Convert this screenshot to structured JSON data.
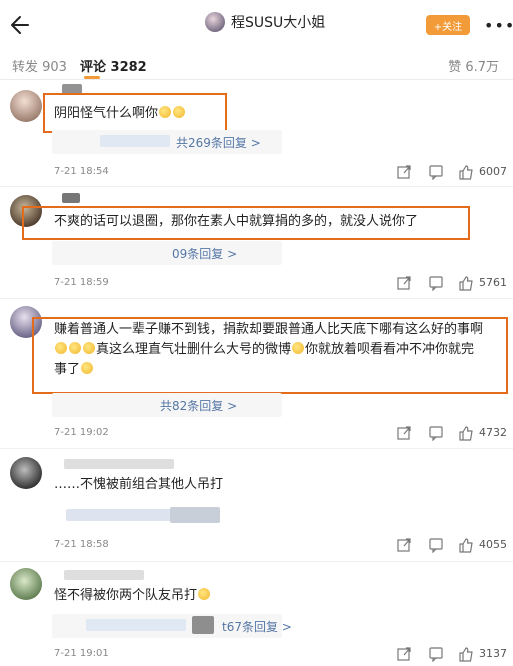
{
  "header": {
    "title": "程SUSU大小姐",
    "follow_label": "+关注",
    "more_glyph": "•••"
  },
  "tabs": {
    "repost": "转发 903",
    "comments": "评论 3282",
    "likes": "赞 6.7万"
  },
  "colors": {
    "accent": "#f29b38",
    "highlight_box": "#e46b1c",
    "link": "#5577a6"
  },
  "icons": [
    "back-arrow-icon",
    "share-icon",
    "comment-icon",
    "like-icon",
    "more-icon"
  ],
  "comments": [
    {
      "text": "阴阳怪气什么啊你",
      "emoji_count": 2,
      "replies": "共269条回复 >",
      "time": "7-21 18:54",
      "likes": "6007"
    },
    {
      "text": "不爽的话可以退圈，那你在素人中就算捐的多的，就没人说你了",
      "replies": "09条回复 >",
      "time": "7-21 18:59",
      "likes": "5761"
    },
    {
      "line1": "赚着普通人一辈子赚不到钱，捐款却要跟普通人比天底下哪有这么好的事啊",
      "line2": "真这么理直气壮删什么大号的微博",
      "line2b": "你就放着呗看看冲不冲你就完",
      "line3": "事了",
      "replies": "共82条回复 >",
      "time": "7-21 19:02",
      "likes": "4732"
    },
    {
      "text": "……不愧被前组合其他人吊打",
      "time": "7-21 18:58",
      "likes": "4055"
    },
    {
      "text": "怪不得被你两个队友吊打",
      "replies": "t67条回复 >",
      "time": "7-21 19:01",
      "likes": "3137"
    }
  ]
}
